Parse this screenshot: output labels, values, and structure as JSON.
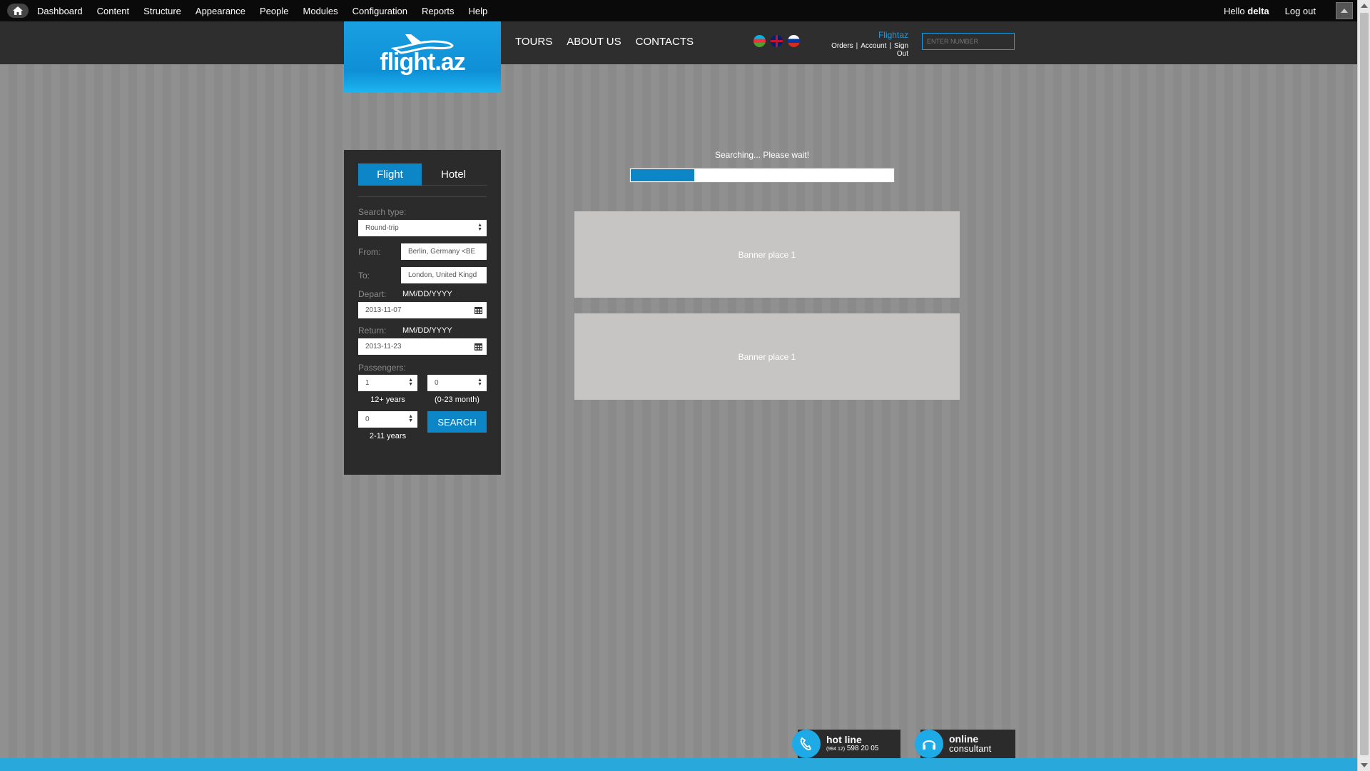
{
  "admin_bar": {
    "menu": [
      "Dashboard",
      "Content",
      "Structure",
      "Appearance",
      "People",
      "Modules",
      "Configuration",
      "Reports",
      "Help"
    ],
    "hello": "Hello",
    "username": "delta",
    "logout": "Log out"
  },
  "header": {
    "logo_text": "flight.az",
    "nav": [
      "TOURS",
      "ABOUT US",
      "CONTACTS"
    ],
    "flags": [
      "az",
      "en",
      "ru"
    ],
    "user_name": "Flightaz",
    "user_links": [
      "Orders",
      "Account",
      "Sign Out"
    ],
    "number_placeholder": "ENTER NUMBER"
  },
  "search": {
    "tabs": [
      "Flight",
      "Hotel"
    ],
    "active_tab": "Flight",
    "search_type_label": "Search type:",
    "search_type_value": "Round-trip",
    "from_label": "From:",
    "from_value": "Berlin, Germany <BE",
    "to_label": "To:",
    "to_value": "London, United Kingd",
    "depart_label": "Depart:",
    "depart_hint": "MM/DD/YYYY",
    "depart_value": "2013-11-07",
    "return_label": "Return:",
    "return_hint": "MM/DD/YYYY",
    "return_value": "2013-11-23",
    "passengers_label": "Passengers:",
    "adults_value": "1",
    "adults_label": "12+ years",
    "infants_value": "0",
    "infants_label": "(0-23 month)",
    "children_value": "0",
    "children_label": "2-11 years",
    "search_button": "SEARCH"
  },
  "progress": {
    "text": "Searching... Please wait!",
    "percent": 24
  },
  "banners": [
    "Banner place 1",
    "Banner place 1"
  ],
  "footer": {
    "hotline_title": "hot line",
    "hotline_phone_prefix": "(994 12)",
    "hotline_phone": "598 20 05",
    "consultant_title": "online",
    "consultant_sub": "consultant"
  },
  "colors": {
    "accent": "#0d86c8",
    "link": "#1e9be0",
    "panel": "#2b2b2b",
    "footer": "#29a8dc"
  }
}
